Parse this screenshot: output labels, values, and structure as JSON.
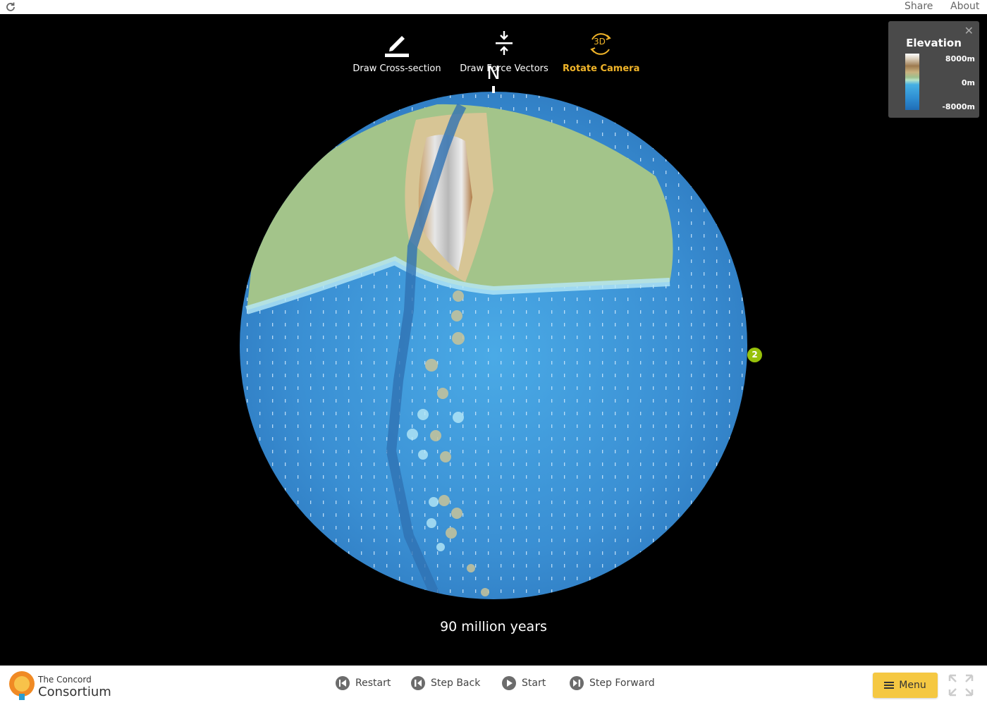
{
  "topbar": {
    "share": "Share",
    "about": "About",
    "reload_icon": "reload-icon"
  },
  "toolbar": {
    "cross_section": {
      "label": "Draw Cross-section",
      "icon": "pencil-icon"
    },
    "force_vectors": {
      "label": "Draw Force Vectors",
      "icon": "compress-arrows-icon"
    },
    "rotate_camera": {
      "label": "Rotate Camera",
      "icon": "rotate-3d-icon",
      "badge": "3D",
      "active": true
    }
  },
  "globe": {
    "north_label": "N",
    "marker_label": "2"
  },
  "time_label": "90 million years",
  "legend": {
    "title": "Elevation",
    "max": "8000m",
    "mid": "0m",
    "min": "-8000m",
    "close": "✕"
  },
  "brand": {
    "line1": "The Concord",
    "line2": "Consortium"
  },
  "controls": {
    "restart": "Restart",
    "step_back": "Step Back",
    "start": "Start",
    "step_forward": "Step Forward"
  },
  "menu": {
    "label": "Menu"
  },
  "colors": {
    "accent": "#f0b429",
    "menu_bg": "#f5c842",
    "ocean": "#3a91d6",
    "land": "#a3c48a",
    "marker": "#97c10a"
  }
}
